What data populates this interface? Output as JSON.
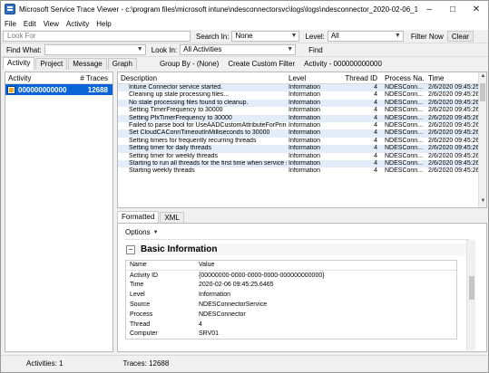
{
  "window": {
    "title": "Microsoft Service Trace Viewer - c:\\program files\\microsoft intune\\ndesconnectorsvc\\logs\\logs\\ndesconnector_2020-02-06_14452...",
    "minimize": "–",
    "maximize": "□",
    "close": "✕"
  },
  "menu": [
    "File",
    "Edit",
    "View",
    "Activity",
    "Help"
  ],
  "toolbar1": {
    "lookfor_placeholder": "Look For",
    "search_in_label": "Search In:",
    "search_in_value": "None",
    "level_label": "Level:",
    "level_value": "All",
    "filter_now": "Filter Now",
    "clear": "Clear"
  },
  "toolbar2": {
    "find_what_label": "Find What:",
    "find_what_value": "",
    "look_in_label": "Look In:",
    "look_in_value": "All Activities",
    "find": "Find"
  },
  "left_tabs": [
    "Activity",
    "Project",
    "Message",
    "Graph"
  ],
  "subtoolbar": {
    "group_by": "Group By - (None)",
    "create_filter": "Create Custom Filter",
    "activity": "Activity - 000000000000"
  },
  "activity_list": {
    "header_activity": "Activity",
    "header_traces": "# Traces",
    "rows": [
      {
        "name": "000000000000",
        "traces": "12688"
      }
    ]
  },
  "trace_list": {
    "headers": {
      "description": "Description",
      "level": "Level",
      "thread": "Thread ID",
      "process": "Process Na...",
      "time": "Time"
    },
    "rows": [
      {
        "description": "Intune Connector service started.",
        "level": "Information",
        "thread": "4",
        "process": "NDESConn...",
        "time": "2/6/2020 09:45:25"
      },
      {
        "description": "Cleaning up stale processing files...",
        "level": "Information",
        "thread": "4",
        "process": "NDESConn...",
        "time": "2/6/2020 09:45:26"
      },
      {
        "description": "No stale processing files found to cleanup.",
        "level": "Information",
        "thread": "4",
        "process": "NDESConn...",
        "time": "2/6/2020 09:45:26"
      },
      {
        "description": "Setting TimerFrequency to 30000",
        "level": "Information",
        "thread": "4",
        "process": "NDESConn...",
        "time": "2/6/2020 09:45:26"
      },
      {
        "description": "Setting PfxTimerFrequency to 30000",
        "level": "Information",
        "thread": "4",
        "process": "NDESConn...",
        "time": "2/6/2020 09:45:26"
      },
      {
        "description": "Failed to parse bool for UseAADCustomAttributeForPrinci...",
        "level": "Information",
        "thread": "4",
        "process": "NDESConn...",
        "time": "2/6/2020 09:45:26"
      },
      {
        "description": "Set CloudCAConnTimeoutInMilliseconds to 30000",
        "level": "Information",
        "thread": "4",
        "process": "NDESConn...",
        "time": "2/6/2020 09:45:26"
      },
      {
        "description": "Setting timers for frequently recurring threads",
        "level": "Information",
        "thread": "4",
        "process": "NDESConn...",
        "time": "2/6/2020 09:45:26"
      },
      {
        "description": "Setting timer for daily threads",
        "level": "Information",
        "thread": "4",
        "process": "NDESConn...",
        "time": "2/6/2020 09:45:26"
      },
      {
        "description": "Setting timer for weekly threads",
        "level": "Information",
        "thread": "4",
        "process": "NDESConn...",
        "time": "2/6/2020 09:45:26"
      },
      {
        "description": "Starting to run all threads for the first time when service s...",
        "level": "Information",
        "thread": "4",
        "process": "NDESConn...",
        "time": "2/6/2020 09:45:26"
      },
      {
        "description": "Starting weekly threads",
        "level": "Information",
        "thread": "4",
        "process": "NDESConn...",
        "time": "2/6/2020 09:45:26"
      }
    ]
  },
  "bottom_tabs": [
    "Formatted",
    "XML"
  ],
  "details": {
    "options_label": "Options",
    "section_title": "Basic Information",
    "header_name": "Name",
    "header_value": "Value",
    "props": [
      {
        "name": "Activity ID",
        "value": "{00000000-0000-0000-0000-000000000000}"
      },
      {
        "name": "Time",
        "value": "2020-02-06 09:45:25.6465"
      },
      {
        "name": "Level",
        "value": "Information"
      },
      {
        "name": "Source",
        "value": "NDESConnectorService"
      },
      {
        "name": "Process",
        "value": "NDESConnector"
      },
      {
        "name": "Thread",
        "value": "4"
      },
      {
        "name": "Computer",
        "value": "SRV01"
      }
    ]
  },
  "status": {
    "activities": "Activities: 1",
    "traces": "Traces: 12688"
  }
}
